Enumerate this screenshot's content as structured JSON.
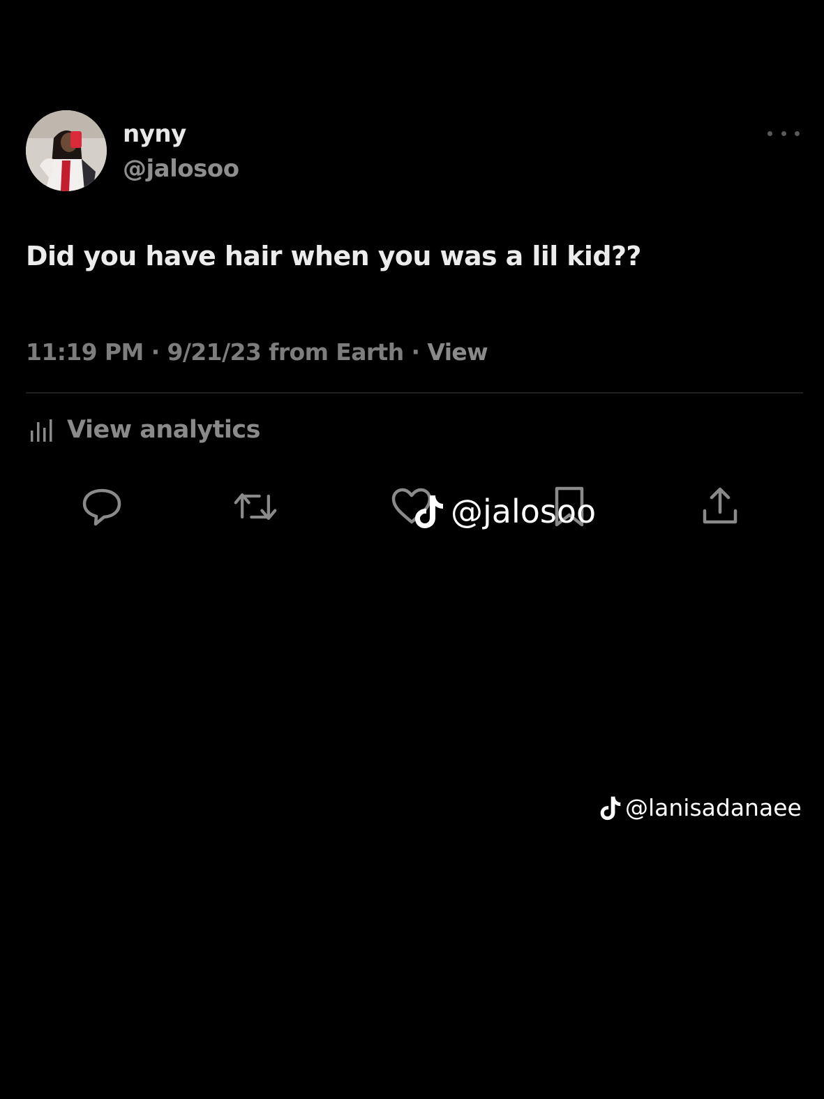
{
  "tweet": {
    "author": {
      "display_name": "nyny",
      "handle": "@jalosoo"
    },
    "text": "Did you have hair when you was a lil kid??",
    "meta": {
      "time": "11:19 PM",
      "separator": "·",
      "date": "9/21/23",
      "source": "from Earth",
      "view_label": "View"
    },
    "analytics_label": "View analytics",
    "actions": [
      {
        "name": "reply",
        "icon": "reply-bubble-icon"
      },
      {
        "name": "retweet",
        "icon": "retweet-icon"
      },
      {
        "name": "like",
        "icon": "heart-icon"
      },
      {
        "name": "bookmark",
        "icon": "bookmark-icon"
      },
      {
        "name": "share",
        "icon": "share-upload-icon"
      }
    ],
    "more_icon": "more-dots-icon"
  },
  "watermarks": {
    "center_handle": "@jalosoo",
    "corner_handle": "@lanisadanaee",
    "icon": "tiktok-logo-icon"
  },
  "colors": {
    "background": "#000000",
    "primary_text": "#e8e8e8",
    "secondary_text": "#7d7d7d",
    "icon_gray": "#8a8a8a",
    "watermark": "#ffffff"
  }
}
